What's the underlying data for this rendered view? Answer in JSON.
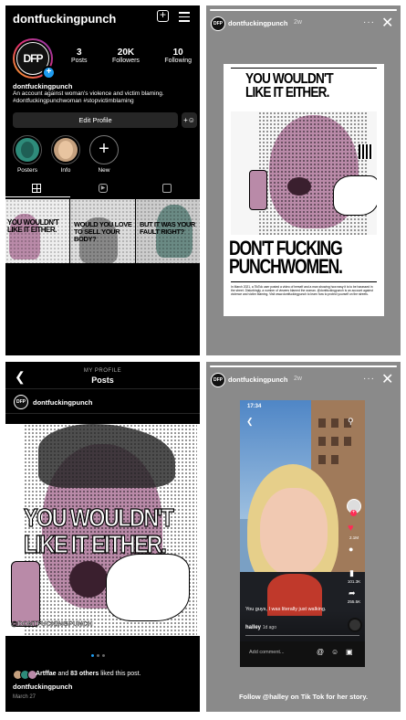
{
  "profile": {
    "username": "dontfuckingpunch",
    "display_name": "dontfuckingpunch",
    "avatar_text": "DFP",
    "stats": [
      {
        "value": "3",
        "label": "Posts"
      },
      {
        "value": "20K",
        "label": "Followers"
      },
      {
        "value": "10",
        "label": "Following"
      }
    ],
    "bio_line1": "An account against woman's violence and victim blaming.",
    "bio_line2": "#dontfuckingpunchwoman #stopvictimblaming",
    "edit_button": "Edit Profile",
    "highlights": [
      {
        "label": "Posters"
      },
      {
        "label": "Info"
      },
      {
        "label": "New"
      }
    ],
    "grid_posts": [
      {
        "text": "YOU WOULDN'T LIKE IT EITHER."
      },
      {
        "text": "WOULD YOU LOVE TO SELL YOUR BODY?"
      },
      {
        "text": "BUT IT WAS YOUR FAULT RIGHT?"
      }
    ]
  },
  "story1": {
    "username": "dontfuckingpunch",
    "time": "2w",
    "poster_headline": "YOU WOULDN'T LIKE IT EITHER.",
    "poster_slogan_1": "DON'T FUCKING",
    "poster_slogan_2": "PUNCHWOMEN.",
    "poster_small": "In March 2021, a TikTok user posted a video of herself and a man showing how easy it is to be harassed in the street. Disturbingly, a number of viewers blamed the woman. @dontfuckingpunch is an account against violence and victim blaming. Visit www.dontfuckingpunch to learn how to protect yourself on the streets."
  },
  "posts_view": {
    "top_label": "MY PROFILE",
    "title": "Posts",
    "username": "dontfuckingpunch",
    "image_line1": "YOU WOULDN'T",
    "image_line2": "LIKE IT EITHER.",
    "watermark": "@DONTFUCKINGPUNCH",
    "likes_user": "Artffae",
    "likes_and": " and ",
    "likes_others": "83 others",
    "likes_suffix": " liked this post.",
    "caption_user": "dontfuckingpunch",
    "date": "March 27"
  },
  "story2": {
    "username": "dontfuckingpunch",
    "time": "2w",
    "tiktok_time": "17:34",
    "tiktok_caption": "You guys, I was literally just walking.",
    "tiktok_user": "halley",
    "tiktok_ago": "1d ago",
    "comment_placeholder": "Add comment...",
    "side_counts": [
      "2.1M",
      "101.3K",
      "255.5K"
    ],
    "footer": "Follow @halley on Tik Tok for her story."
  },
  "colors": {
    "accent_pink": "#b98aa8",
    "ig_blue": "#1d9bf0",
    "tiktok_red": "#fe2c55"
  }
}
